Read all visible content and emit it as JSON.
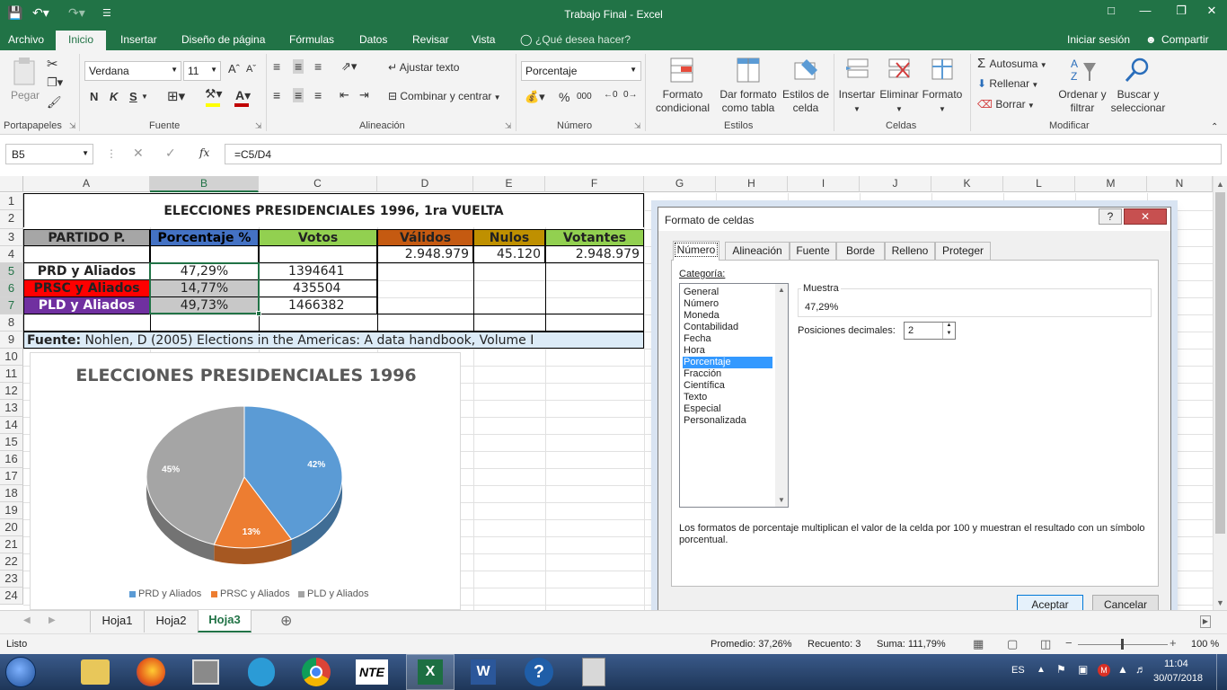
{
  "app": {
    "title": "Trabajo Final - Excel",
    "accent": "#217346"
  },
  "tabs": {
    "archivo": "Archivo",
    "inicio": "Inicio",
    "insertar": "Insertar",
    "diseno": "Diseño de página",
    "formulas": "Fórmulas",
    "datos": "Datos",
    "revisar": "Revisar",
    "vista": "Vista",
    "tell": "¿Qué desea hacer?",
    "login": "Iniciar sesión",
    "share": "Compartir"
  },
  "ribbon": {
    "paste": "Pegar",
    "font_name": "Verdana",
    "font_size": "11",
    "bold": "N",
    "italic": "K",
    "underline": "S",
    "wrap": "Ajustar texto",
    "merge": "Combinar y centrar",
    "number_format": "Porcentaje",
    "percent": "%",
    "thousands": "000",
    "cond_format": "Formato condicional",
    "as_table": "Dar formato como tabla",
    "cell_styles": "Estilos de celda",
    "insert": "Insertar",
    "delete": "Eliminar",
    "format": "Formato",
    "autosum": "Autosuma",
    "fill": "Rellenar",
    "clear": "Borrar",
    "sort": "Ordenar y filtrar",
    "find": "Buscar y seleccionar",
    "groups": {
      "clipboard": "Portapapeles",
      "font": "Fuente",
      "alignment": "Alineación",
      "number": "Número",
      "styles": "Estilos",
      "cells": "Celdas",
      "edit": "Modificar"
    }
  },
  "formula": {
    "namebox": "B5",
    "fx": "fx",
    "text": "=C5/D4"
  },
  "columns": [
    "A",
    "B",
    "C",
    "D",
    "E",
    "F",
    "G",
    "H",
    "I",
    "J",
    "K",
    "L",
    "M",
    "N"
  ],
  "rows": [
    "1",
    "2",
    "3",
    "4",
    "5",
    "6",
    "7",
    "8",
    "9",
    "10",
    "11",
    "12",
    "13",
    "14",
    "15",
    "16",
    "17",
    "18",
    "19",
    "20",
    "21",
    "22",
    "23",
    "24"
  ],
  "sheet": {
    "title": "ELECCIONES PRESIDENCIALES 1996, 1ra VUELTA",
    "headers": {
      "party": "PARTIDO P.",
      "pct": "Porcentaje %",
      "votes": "Votos",
      "valid": "Válidos",
      "null": "Nulos",
      "voters": "Votantes"
    },
    "row4": {
      "valid": "2.948.979",
      "null": "45.120",
      "voters": "2.948.979"
    },
    "parties": [
      {
        "name": "PRD y Aliados",
        "pct": "47,29%",
        "votes": "1394641"
      },
      {
        "name": "PRSC y Aliados",
        "pct": "14,77%",
        "votes": "435504"
      },
      {
        "name": "PLD y Aliados",
        "pct": "49,73%",
        "votes": "1466382"
      }
    ],
    "source_label": "Fuente:",
    "source_text": " Nohlen, D (2005) Elections in the Americas: A data handbook, Volume I"
  },
  "colors": {
    "party_header": "#a6a6a6",
    "pct_header": "#4472c4",
    "votes_header": "#92d050",
    "valid_header": "#c55a11",
    "null_header": "#bf9000",
    "voters_header": "#92d050",
    "prsc": "#ff0000",
    "pld": "#7030a0"
  },
  "chart_data": {
    "type": "pie",
    "title": "ELECCIONES PRESIDENCIALES 1996",
    "categories": [
      "PRD y Aliados",
      "PRSC y Aliados",
      "PLD y Aliados"
    ],
    "values": [
      42,
      13,
      45
    ],
    "labels": [
      "42%",
      "13%",
      "45%"
    ],
    "colors": [
      "#5b9bd5",
      "#ed7d31",
      "#a5a5a5"
    ],
    "legend": "bottom"
  },
  "dialog": {
    "title": "Formato de celdas",
    "help": "?",
    "tabs": [
      "Número",
      "Alineación",
      "Fuente",
      "Borde",
      "Relleno",
      "Proteger"
    ],
    "category_label": "Categoría:",
    "categories": [
      "General",
      "Número",
      "Moneda",
      "Contabilidad",
      "Fecha",
      "Hora",
      "Porcentaje",
      "Fracción",
      "Científica",
      "Texto",
      "Especial",
      "Personalizada"
    ],
    "sample_label": "Muestra",
    "sample_value": "47,29%",
    "decimals_label": "Posiciones decimales:",
    "decimals_value": "2",
    "description": "Los formatos de porcentaje multiplican el valor de la celda por 100 y muestran el resultado con un símbolo porcentual.",
    "ok": "Aceptar",
    "cancel": "Cancelar"
  },
  "sheets": {
    "tabs": [
      "Hoja1",
      "Hoja2",
      "Hoja3"
    ],
    "active": "Hoja3"
  },
  "status": {
    "ready": "Listo",
    "average": "Promedio: 37,26%",
    "count": "Recuento: 3",
    "sum": "Suma: 111,79%",
    "zoom": "100 %"
  },
  "taskbar": {
    "lang": "ES",
    "time": "11:04",
    "date": "30/07/2018",
    "nte": "NTE"
  }
}
